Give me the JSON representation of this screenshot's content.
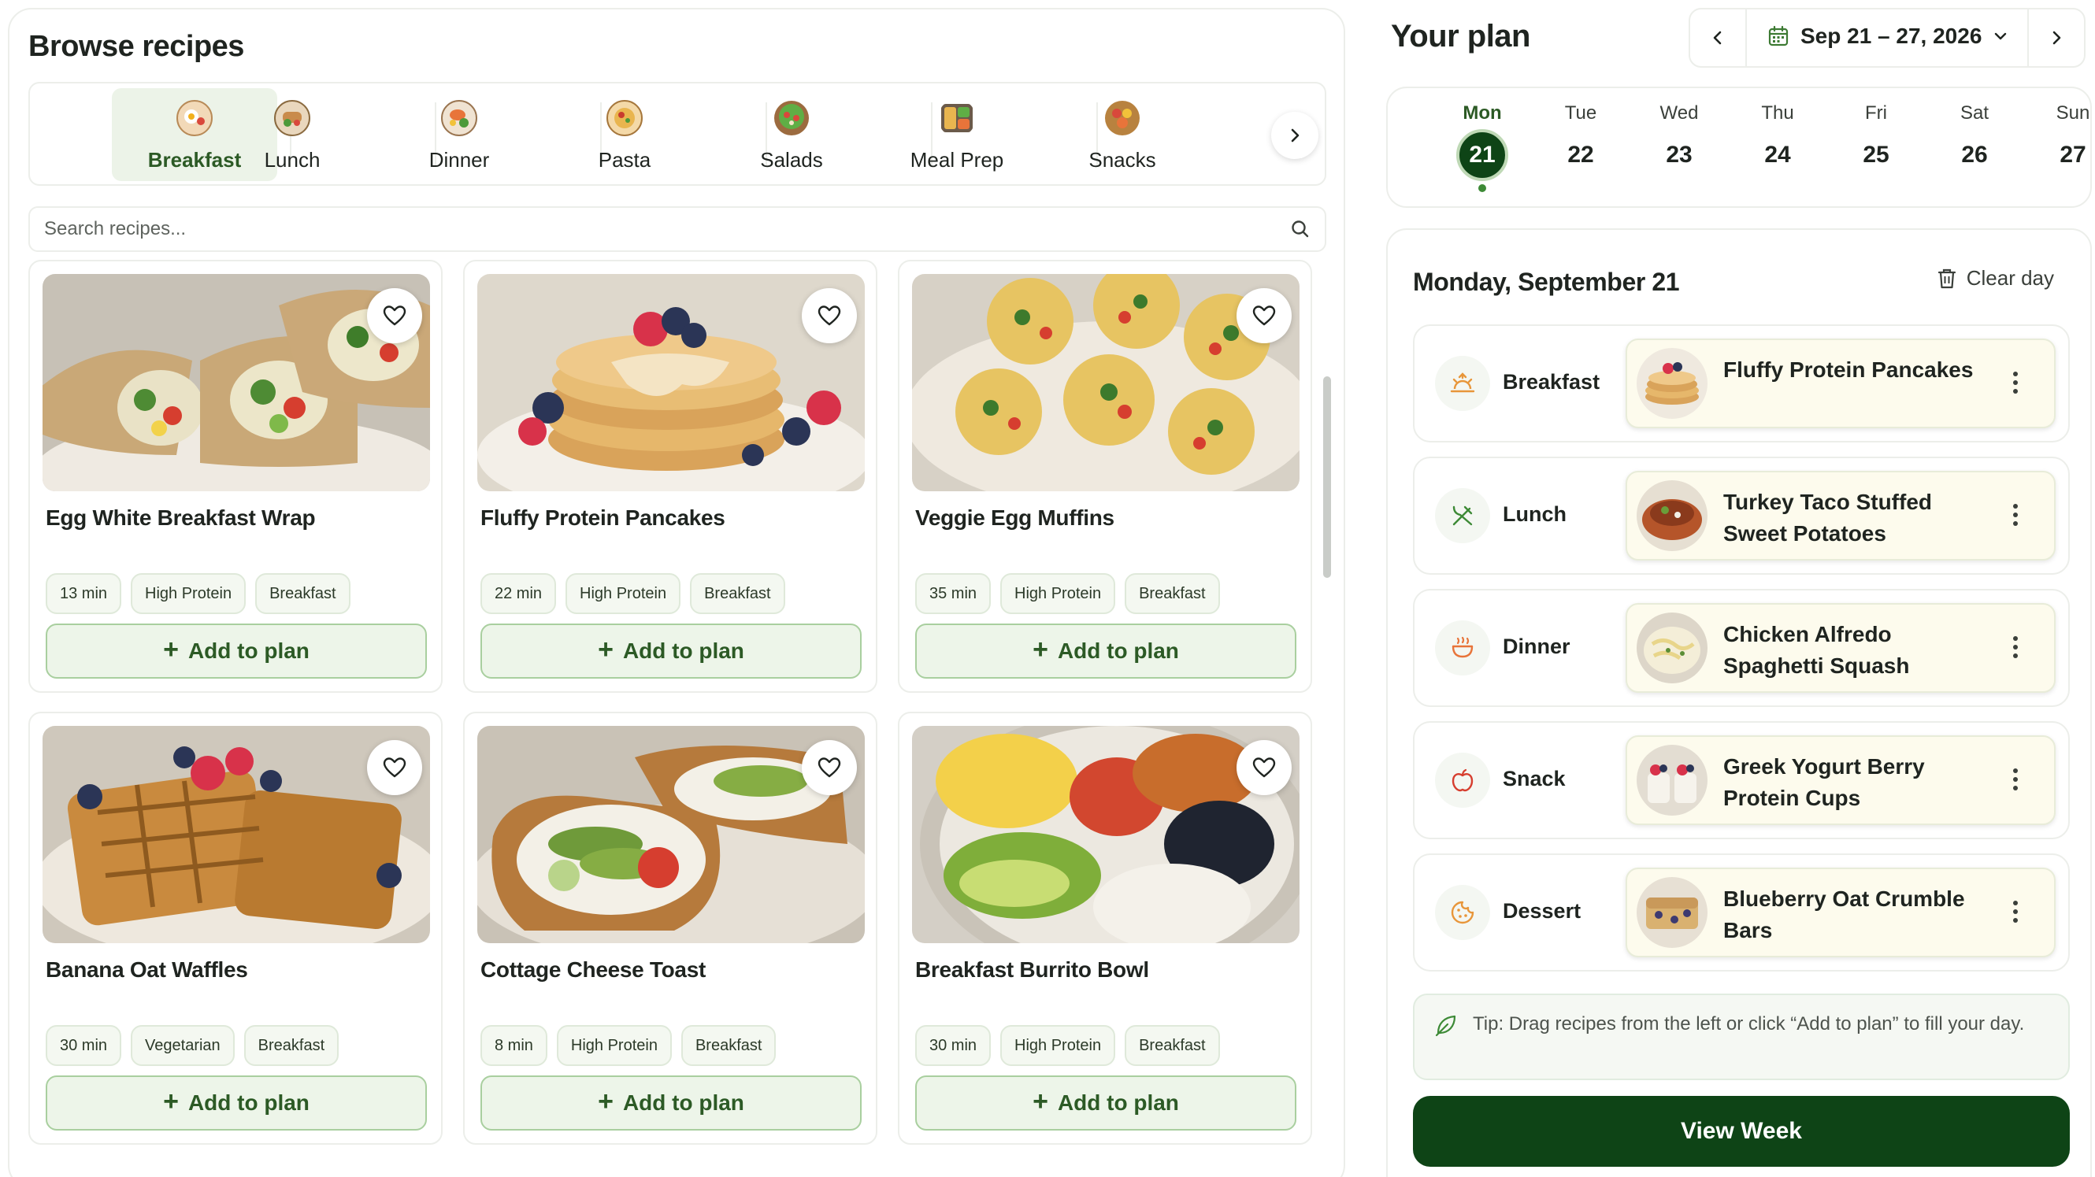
{
  "browse": {
    "title": "Browse recipes",
    "categories": [
      {
        "label": "Breakfast",
        "icon": "breakfast-plate-icon",
        "active": true
      },
      {
        "label": "Lunch",
        "icon": "lunch-plate-icon",
        "active": false
      },
      {
        "label": "Dinner",
        "icon": "dinner-plate-icon",
        "active": false
      },
      {
        "label": "Pasta",
        "icon": "pasta-plate-icon",
        "active": false
      },
      {
        "label": "Salads",
        "icon": "salad-bowl-icon",
        "active": false
      },
      {
        "label": "Meal Prep",
        "icon": "meal-prep-box-icon",
        "active": false
      },
      {
        "label": "Snacks",
        "icon": "snacks-bowl-icon",
        "active": false
      }
    ],
    "search_placeholder": "Search recipes...",
    "add_label": "Add to plan",
    "recipes": [
      {
        "title": "Egg White Breakfast Wrap",
        "time": "13 min",
        "tag": "High Protein",
        "category": "Breakfast"
      },
      {
        "title": "Fluffy Protein Pancakes",
        "time": "22 min",
        "tag": "High Protein",
        "category": "Breakfast"
      },
      {
        "title": "Veggie Egg Muffins",
        "time": "35 min",
        "tag": "High Protein",
        "category": "Breakfast"
      },
      {
        "title": "Banana Oat Waffles",
        "time": "30 min",
        "tag": "Vegetarian",
        "category": "Breakfast"
      },
      {
        "title": "Cottage Cheese Toast",
        "time": "8 min",
        "tag": "High Protein",
        "category": "Breakfast"
      },
      {
        "title": "Breakfast Burrito Bowl",
        "time": "30 min",
        "tag": "High Protein",
        "category": "Breakfast"
      }
    ]
  },
  "plan": {
    "title": "Your plan",
    "week_range": "Sep 21 – 27, 2026",
    "days": [
      {
        "name": "Mon",
        "num": "21",
        "active": true
      },
      {
        "name": "Tue",
        "num": "22",
        "active": false
      },
      {
        "name": "Wed",
        "num": "23",
        "active": false
      },
      {
        "name": "Thu",
        "num": "24",
        "active": false
      },
      {
        "name": "Fri",
        "num": "25",
        "active": false
      },
      {
        "name": "Sat",
        "num": "26",
        "active": false
      },
      {
        "name": "Sun",
        "num": "27",
        "active": false
      }
    ],
    "day_title": "Monday, September 21",
    "clear_label": "Clear day",
    "meals": [
      {
        "slot": "Breakfast",
        "icon": "sunrise-icon",
        "recipe": "Fluffy Protein Pancakes"
      },
      {
        "slot": "Lunch",
        "icon": "utensils-icon",
        "recipe": "Turkey Taco Stuffed Sweet Potatoes"
      },
      {
        "slot": "Dinner",
        "icon": "bowl-icon",
        "recipe": "Chicken Alfredo Spaghetti Squash"
      },
      {
        "slot": "Snack",
        "icon": "apple-icon",
        "recipe": "Greek Yogurt Berry Protein Cups"
      },
      {
        "slot": "Dessert",
        "icon": "cookie-icon",
        "recipe": "Blueberry Oat Crumble Bars"
      }
    ],
    "tip": "Tip: Drag recipes from the left or click “Add to plan” to fill your day.",
    "view_week_label": "View Week"
  },
  "colors": {
    "brand_dark_green": "#0e4416",
    "accent_green": "#2c5a25",
    "meal_card_bg": "#fdfbed"
  }
}
